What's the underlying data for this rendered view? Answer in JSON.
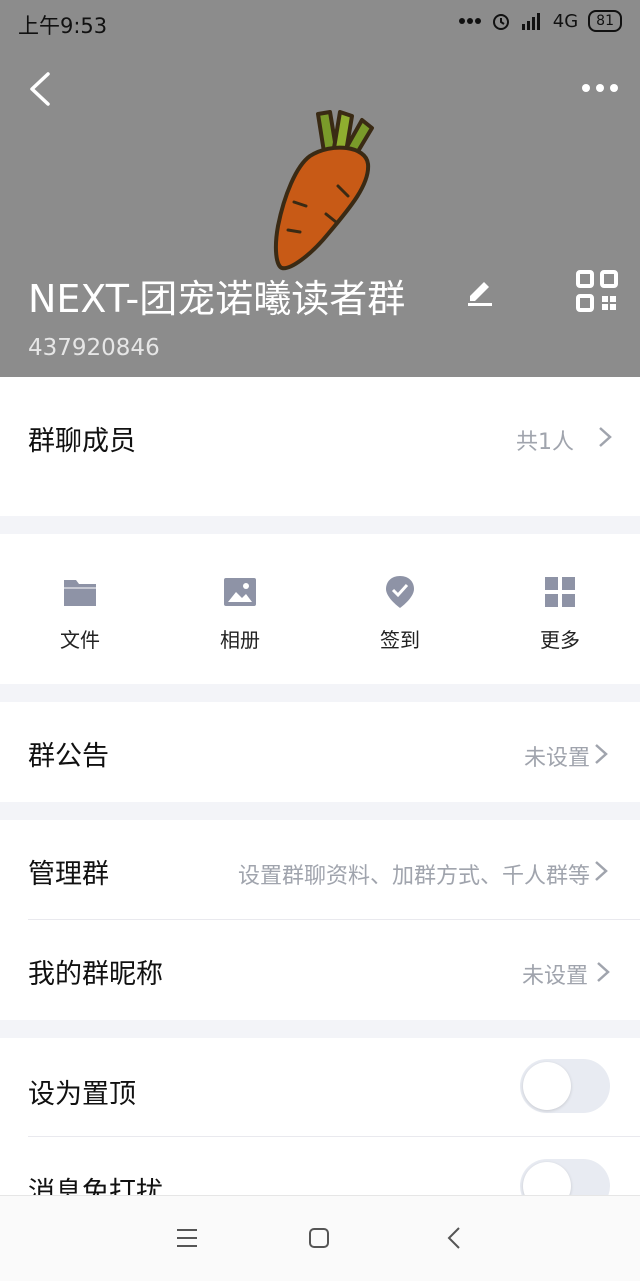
{
  "status_bar": {
    "time": "上午9:53",
    "network": "4G",
    "battery": "81"
  },
  "header": {
    "group_name": "NEXT-团宠诺曦读者群",
    "group_id": "437920846"
  },
  "members": {
    "label": "群聊成员",
    "count": "共1人"
  },
  "tools": [
    {
      "label": "文件",
      "icon": "folder-icon"
    },
    {
      "label": "相册",
      "icon": "image-icon"
    },
    {
      "label": "签到",
      "icon": "checkin-icon"
    },
    {
      "label": "更多",
      "icon": "grid-icon"
    }
  ],
  "announcement": {
    "label": "群公告",
    "value": "未设置"
  },
  "manage": {
    "label": "管理群",
    "value": "设置群聊资料、加群方式、千人群等"
  },
  "nickname": {
    "label": "我的群昵称",
    "value": "未设置"
  },
  "pin_top": {
    "label": "设为置顶",
    "on": false
  },
  "mute": {
    "label": "消息免打扰",
    "on": false
  },
  "colors": {
    "header_bg": "#8c8c8c",
    "page_bg": "#f3f4f8",
    "icon_gray": "#8e93a6",
    "value_gray": "#a0a4ad"
  }
}
